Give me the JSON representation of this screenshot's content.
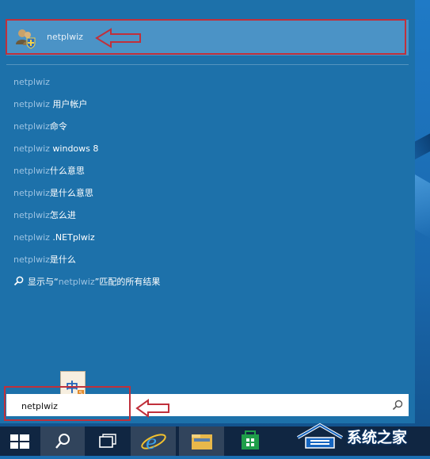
{
  "top_result": {
    "label": "netplwiz",
    "icon": "users-shield-icon"
  },
  "suggestions": [
    {
      "query": "netplwiz",
      "suffix": ""
    },
    {
      "query": "netplwiz",
      "suffix": " 用户帐户"
    },
    {
      "query": "netplwiz",
      "suffix": "命令"
    },
    {
      "query": "netplwiz",
      "suffix": " windows 8"
    },
    {
      "query": "netplwiz",
      "suffix": "什么意思"
    },
    {
      "query": "netplwiz",
      "suffix": "是什么意思"
    },
    {
      "query": "netplwiz",
      "suffix": "怎么进"
    },
    {
      "query": "netplwiz",
      "suffix": " .NETplwiz"
    },
    {
      "query": "netplwiz",
      "suffix": "是什么"
    }
  ],
  "search_all": {
    "prefix": "显示与“",
    "query": "netplwiz",
    "suffix": "”匹配的所有结果"
  },
  "search_box": {
    "value": "netplwiz"
  },
  "ime": {
    "char": "中",
    "badge": "S"
  },
  "taskbar": {
    "items": [
      "start-icon",
      "search-icon",
      "task-view-icon",
      "ie-icon",
      "file-explorer-icon",
      "store-icon"
    ]
  },
  "watermark": {
    "text": "系统之家"
  },
  "colors": {
    "panel": "#1d71aa",
    "highlight": "#4b93c6",
    "annotation": "#c0303b",
    "taskbar": "#102642"
  }
}
